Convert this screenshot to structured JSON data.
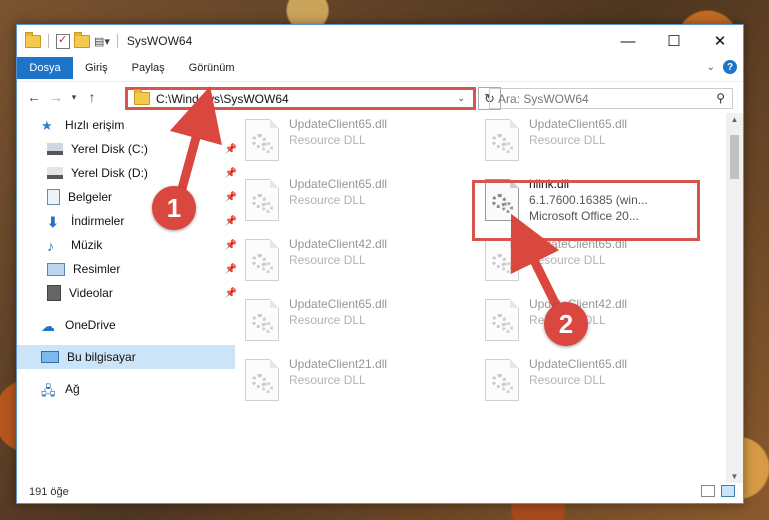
{
  "window": {
    "title": "SysWOW64",
    "controls": {
      "minimize": "—",
      "maximize": "☐",
      "close": "✕"
    }
  },
  "ribbon": {
    "tabs": [
      "Dosya",
      "Giriş",
      "Paylaş",
      "Görünüm"
    ],
    "help": "?"
  },
  "address": {
    "path": "C:\\Windows\\SysWOW64",
    "search_placeholder": "Ara: SysWOW64"
  },
  "sidebar": {
    "items": [
      {
        "label": "Hızlı erişim",
        "icon": "star-icon"
      },
      {
        "label": "Yerel Disk (C:)",
        "icon": "drive-icon",
        "pinned": true
      },
      {
        "label": "Yerel Disk (D:)",
        "icon": "drive-icon",
        "pinned": true
      },
      {
        "label": "Belgeler",
        "icon": "documents-icon",
        "pinned": true
      },
      {
        "label": "İndirmeler",
        "icon": "download-icon",
        "pinned": true
      },
      {
        "label": "Müzik",
        "icon": "music-icon",
        "pinned": true
      },
      {
        "label": "Resimler",
        "icon": "pictures-icon",
        "pinned": true
      },
      {
        "label": "Videolar",
        "icon": "videos-icon",
        "pinned": true
      },
      {
        "label": "OneDrive",
        "icon": "cloud-icon"
      },
      {
        "label": "Bu bilgisayar",
        "icon": "computer-icon",
        "selected": true
      },
      {
        "label": "Ağ",
        "icon": "network-icon"
      }
    ]
  },
  "files": [
    {
      "name": "UpdateClient65.dll",
      "desc": "Resource DLL"
    },
    {
      "name": "UpdateClient65.dll",
      "desc": "Resource DLL"
    },
    {
      "name": "UpdateClient65.dll",
      "desc": "Resource DLL"
    },
    {
      "name": "hlink.dll",
      "desc": "6.1.7600.16385 (win...",
      "desc2": "Microsoft Office 20...",
      "highlighted": true
    },
    {
      "name": "UpdateClient42.dll",
      "desc": "Resource DLL"
    },
    {
      "name": "UpdateClient65.dll",
      "desc": "Resource DLL"
    },
    {
      "name": "UpdateClient65.dll",
      "desc": "Resource DLL"
    },
    {
      "name": "UpdateClient42.dll",
      "desc": "Resource DLL"
    },
    {
      "name": "UpdateClient21.dll",
      "desc": "Resource DLL"
    },
    {
      "name": "UpdateClient65.dll",
      "desc": "Resource DLL"
    }
  ],
  "status": {
    "count": "191 öğe"
  },
  "annotations": {
    "step1": "1",
    "step2": "2"
  },
  "colors": {
    "accent": "#1e74c8",
    "highlight": "#d9534f",
    "selection": "#cce4f7"
  }
}
